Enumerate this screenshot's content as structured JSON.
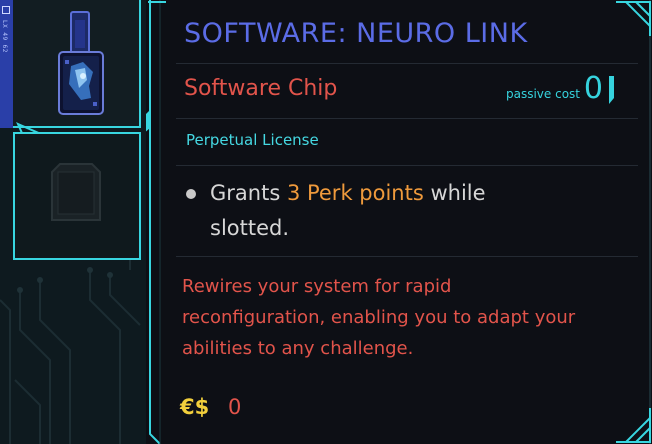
{
  "item": {
    "title": "SOFTWARE: NEURO LINK",
    "type": "Software Chip",
    "passive_cost_label": "passive cost",
    "passive_cost_value": "0",
    "license": "Perpetual License",
    "perk": {
      "line1_prefix": "Grants ",
      "line1_highlight": "3 Perk points",
      "line1_suffix": " while",
      "line2": "slotted."
    },
    "description_lines": [
      "Rewires your system for rapid",
      "reconfiguration, enabling you to adapt your",
      "abilities to any challenge."
    ],
    "price_currency": "€$",
    "price_value": "0"
  },
  "inventory": {
    "side_strip_text": "LX 49 62"
  },
  "icons": {
    "chip": "software-chip-icon",
    "empty_slot": "empty-chip-slot-icon",
    "selector": "selector-arrow-icon",
    "strip": "slot-marker-icon"
  },
  "colors": {
    "title": "#5b6ce6",
    "subtitle_red": "#e2544b",
    "accent_cyan": "#36d3de",
    "perk_orange": "#ef9a3c",
    "currency_yellow": "#f2cf3c"
  }
}
